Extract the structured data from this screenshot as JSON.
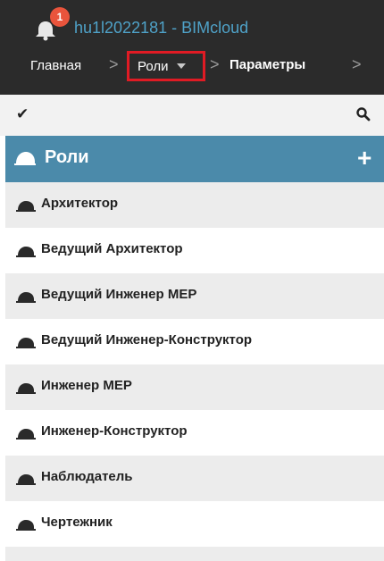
{
  "header": {
    "notification_count": "1",
    "server_title": "hu1l2022181 - BIMcloud"
  },
  "breadcrumb": {
    "home": "Главная",
    "roles": "Роли",
    "params": "Параметры"
  },
  "panel": {
    "title": "Роли",
    "add_label": "+"
  },
  "roles": [
    "Архитектор",
    "Ведущий Архитектор",
    "Ведущий Инженер MEP",
    "Ведущий Инженер-Конструктор",
    "Инженер MEP",
    "Инженер-Конструктор",
    "Наблюдатель",
    "Чертежник"
  ],
  "colors": {
    "header_bg": "#2b2b2b",
    "accent": "#4b8aaa",
    "title_link": "#4fa2c8",
    "badge": "#e9543c",
    "highlight_border": "#e01b24"
  }
}
